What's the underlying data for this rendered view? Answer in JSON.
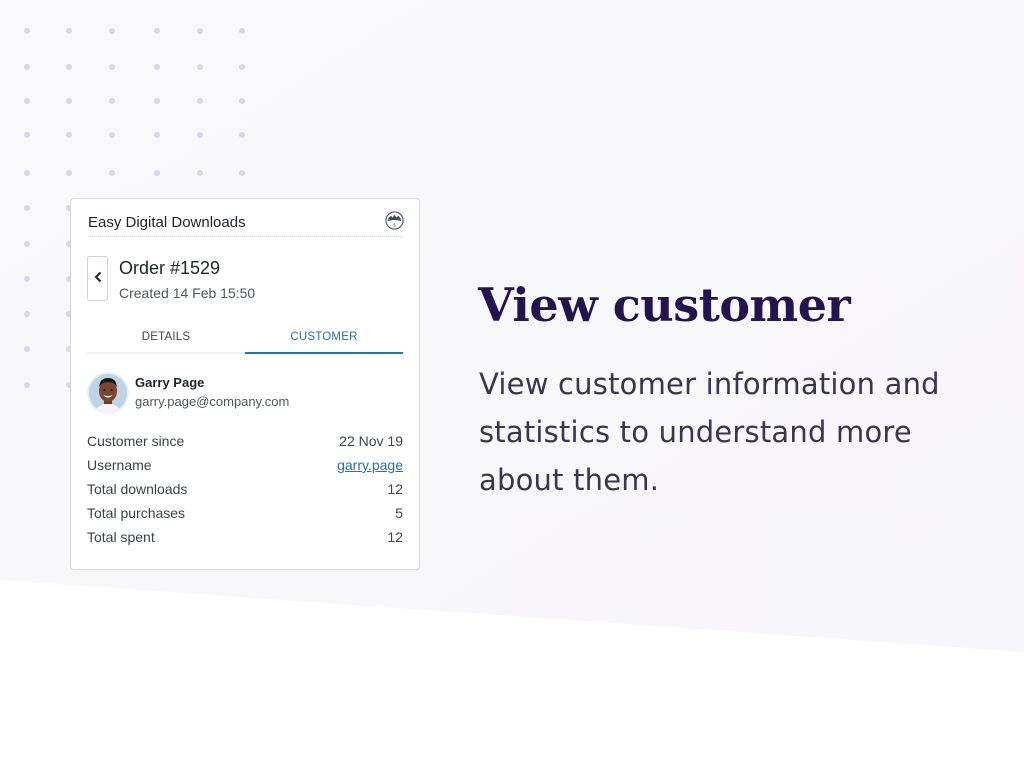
{
  "card": {
    "app_name": "Easy Digital Downloads",
    "logo_icon": "edd-logo-icon",
    "back_icon": "chevron-left-icon",
    "order_title": "Order #1529",
    "order_created": "Created 14 Feb 15:50",
    "tabs": [
      {
        "label": "DETAILS",
        "active": false
      },
      {
        "label": "CUSTOMER",
        "active": true
      }
    ],
    "customer": {
      "name": "Garry Page",
      "email": "garry.page@company.com"
    },
    "stats": [
      {
        "label": "Customer since",
        "value": "22 Nov 19",
        "link": false
      },
      {
        "label": "Username",
        "value": "garry.page",
        "link": true
      },
      {
        "label": "Total downloads",
        "value": "12",
        "link": false
      },
      {
        "label": "Total purchases",
        "value": "5",
        "link": false
      },
      {
        "label": "Total spent",
        "value": "12",
        "link": false
      }
    ]
  },
  "hero": {
    "title": "View customer",
    "description": "View customer information and statistics to understand more about them."
  },
  "colors": {
    "accent": "#2271b1",
    "title": "#22144f",
    "text": "#3a3551"
  }
}
